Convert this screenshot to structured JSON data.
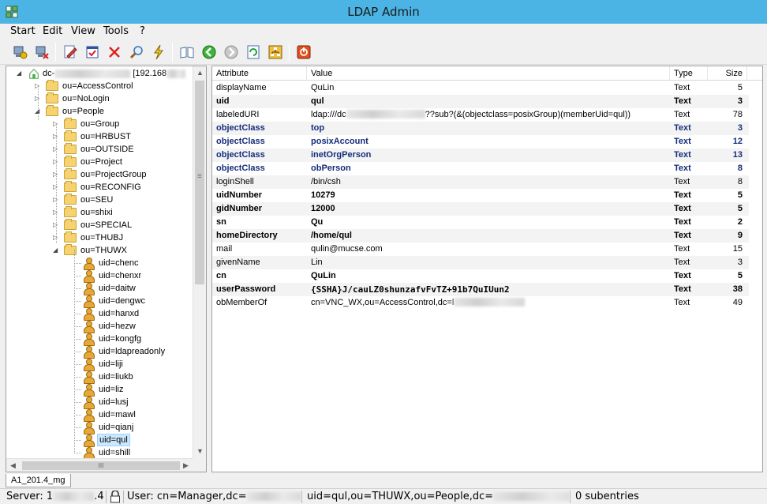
{
  "window": {
    "title": "LDAP Admin"
  },
  "menu": [
    "Start",
    "Edit",
    "View",
    "Tools",
    "?"
  ],
  "toolbar": {
    "buttons": [
      "connect-icon",
      "disconnect-icon",
      "edit-entry-icon",
      "properties-icon",
      "delete-icon",
      "search-icon",
      "lightning-icon",
      "bookmarks-icon",
      "back-icon",
      "forward-icon",
      "refresh-icon",
      "schema-icon",
      "exit-icon"
    ]
  },
  "tree": {
    "root_label": "dc-",
    "root_suffix": "[192.168",
    "nodes": [
      {
        "label": "ou=AccessControl",
        "type": "folder",
        "expanded": false
      },
      {
        "label": "ou=NoLogin",
        "type": "folder",
        "expanded": false
      },
      {
        "label": "ou=People",
        "type": "folder",
        "expanded": true
      },
      {
        "label": "ou=Group",
        "type": "folder",
        "expanded": false
      },
      {
        "label": "ou=HRBUST",
        "type": "folder",
        "expanded": false
      },
      {
        "label": "ou=OUTSIDE",
        "type": "folder",
        "expanded": false
      },
      {
        "label": "ou=Project",
        "type": "folder",
        "expanded": false
      },
      {
        "label": "ou=ProjectGroup",
        "type": "folder",
        "expanded": false
      },
      {
        "label": "ou=RECONFIG",
        "type": "folder",
        "expanded": false
      },
      {
        "label": "ou=SEU",
        "type": "folder",
        "expanded": false
      },
      {
        "label": "ou=shixi",
        "type": "folder",
        "expanded": false
      },
      {
        "label": "ou=SPECIAL",
        "type": "folder",
        "expanded": false
      },
      {
        "label": "ou=THUBJ",
        "type": "folder",
        "expanded": false
      },
      {
        "label": "ou=THUWX",
        "type": "folder",
        "expanded": true
      },
      {
        "label": "uid=chenc",
        "type": "user"
      },
      {
        "label": "uid=chenxr",
        "type": "user"
      },
      {
        "label": "uid=daitw",
        "type": "user"
      },
      {
        "label": "uid=dengwc",
        "type": "user"
      },
      {
        "label": "uid=hanxd",
        "type": "user"
      },
      {
        "label": "uid=hezw",
        "type": "user"
      },
      {
        "label": "uid=kongfg",
        "type": "user"
      },
      {
        "label": "uid=ldapreadonly",
        "type": "user"
      },
      {
        "label": "uid=liji",
        "type": "user"
      },
      {
        "label": "uid=liukb",
        "type": "user"
      },
      {
        "label": "uid=liz",
        "type": "user"
      },
      {
        "label": "uid=lusj",
        "type": "user"
      },
      {
        "label": "uid=mawl",
        "type": "user"
      },
      {
        "label": "uid=qianj",
        "type": "user"
      },
      {
        "label": "uid=qul",
        "type": "user",
        "selected": true
      },
      {
        "label": "uid=shill",
        "type": "user"
      }
    ],
    "hscroll_grip": "III"
  },
  "table": {
    "headers": {
      "attribute": "Attribute",
      "value": "Value",
      "type": "Type",
      "size": "Size"
    },
    "rows": [
      {
        "attribute": "displayName",
        "value": "QuLin",
        "type": "Text",
        "size": "5",
        "style": "normal"
      },
      {
        "attribute": "uid",
        "value": "qul",
        "type": "Text",
        "size": "3",
        "style": "bold"
      },
      {
        "attribute": "labeledURI",
        "value": "ldap:///dc",
        "value_tail": "??sub?(&(objectclass=posixGroup)(memberUid=qul))",
        "type": "Text",
        "size": "78",
        "style": "normal"
      },
      {
        "attribute": "objectClass",
        "value": "top",
        "type": "Text",
        "size": "3",
        "style": "oc"
      },
      {
        "attribute": "objectClass",
        "value": "posixAccount",
        "type": "Text",
        "size": "12",
        "style": "oc"
      },
      {
        "attribute": "objectClass",
        "value": "inetOrgPerson",
        "type": "Text",
        "size": "13",
        "style": "oc"
      },
      {
        "attribute": "objectClass",
        "value": "obPerson",
        "type": "Text",
        "size": "8",
        "style": "oc"
      },
      {
        "attribute": "loginShell",
        "value": "/bin/csh",
        "type": "Text",
        "size": "8",
        "style": "normal"
      },
      {
        "attribute": "uidNumber",
        "value": "10279",
        "type": "Text",
        "size": "5",
        "style": "bold"
      },
      {
        "attribute": "gidNumber",
        "value": "12000",
        "type": "Text",
        "size": "5",
        "style": "bold"
      },
      {
        "attribute": "sn",
        "value": "Qu",
        "type": "Text",
        "size": "2",
        "style": "bold"
      },
      {
        "attribute": "homeDirectory",
        "value": "/home/qul",
        "type": "Text",
        "size": "9",
        "style": "bold"
      },
      {
        "attribute": "mail",
        "value": "qulin@mucse.com",
        "type": "Text",
        "size": "15",
        "style": "normal"
      },
      {
        "attribute": "givenName",
        "value": "Lin",
        "type": "Text",
        "size": "3",
        "style": "normal"
      },
      {
        "attribute": "cn",
        "value": "QuLin",
        "type": "Text",
        "size": "5",
        "style": "bold"
      },
      {
        "attribute": "userPassword",
        "value": "{SSHA}J/cauLZ0shunzafvFvTZ+91b7QuIUun2",
        "type": "Text",
        "size": "38",
        "style": "bold mono"
      },
      {
        "attribute": "obMemberOf",
        "value": "cn=VNC_WX,ou=AccessControl,dc=l",
        "type": "Text",
        "size": "49",
        "style": "normal"
      }
    ]
  },
  "tab": {
    "label": "A1_201.4_mg"
  },
  "status": {
    "server": "Server: 1",
    "server_tail": ".4",
    "user": "User: cn=Manager,dc=",
    "dn": "uid=qul,ou=THUWX,ou=People,dc=",
    "subentries": "0 subentries"
  },
  "colors": {
    "titlebar": "#4cb4e4",
    "object_class": "#152d7a",
    "selection": "#cce8ff"
  }
}
